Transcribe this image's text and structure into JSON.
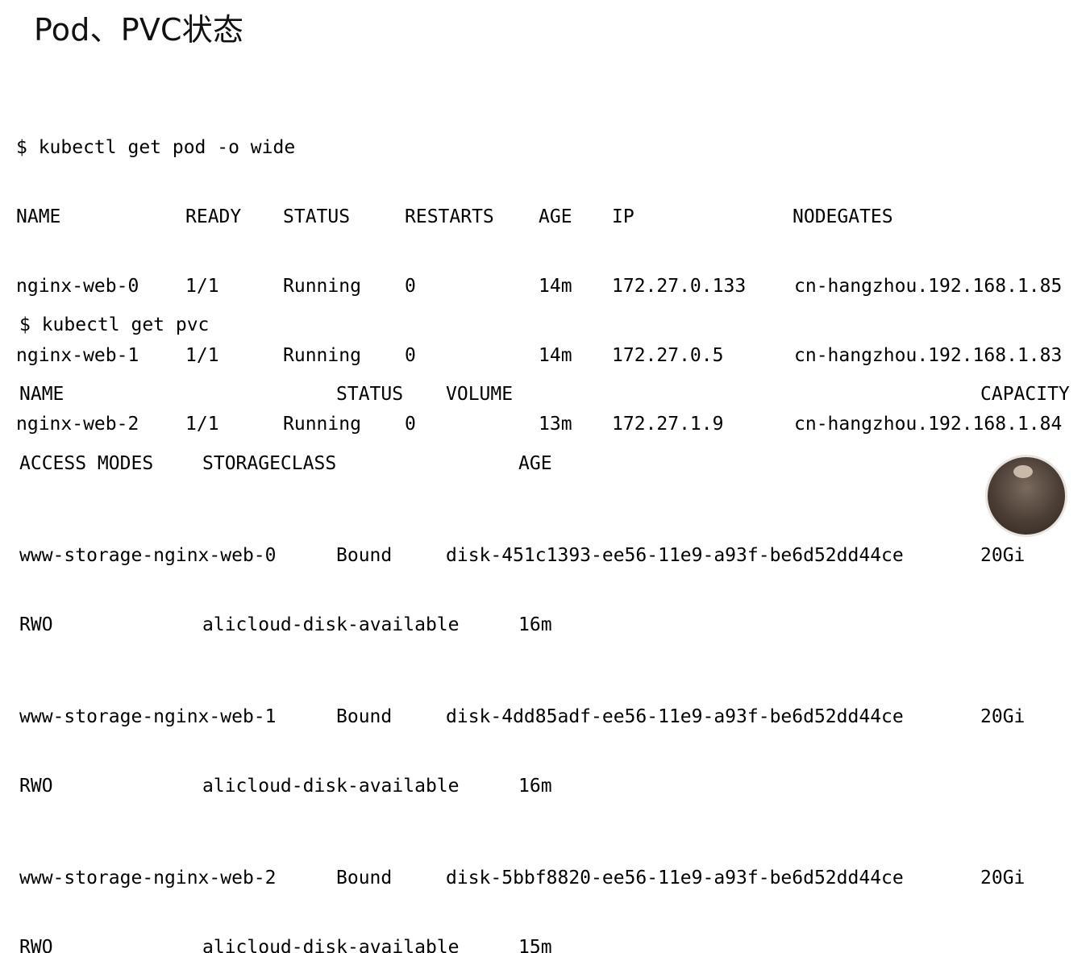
{
  "slide": {
    "title": "Pod、PVC状态"
  },
  "pod_block": {
    "command": "$ kubectl get pod -o wide",
    "headers": [
      "NAME",
      "READY",
      "STATUS",
      "RESTARTS",
      "AGE",
      "IP",
      "NODEGATES"
    ],
    "rows": [
      [
        "nginx-web-0",
        "1/1",
        "Running",
        "0",
        "14m",
        "172.27.0.133",
        "cn-hangzhou.192.168.1.85"
      ],
      [
        "nginx-web-1",
        "1/1",
        "Running",
        "0",
        "14m",
        "172.27.0.5",
        "cn-hangzhou.192.168.1.83"
      ],
      [
        "nginx-web-2",
        "1/1",
        "Running",
        "0",
        "13m",
        "172.27.1.9",
        "cn-hangzhou.192.168.1.84"
      ]
    ]
  },
  "pvc_block": {
    "command": "$ kubectl get pvc",
    "headers_line1": [
      "NAME",
      "STATUS",
      "VOLUME",
      "CAPACITY"
    ],
    "headers_line2": [
      "ACCESS MODES",
      "STORAGECLASS",
      "AGE"
    ],
    "rows": [
      {
        "name": "www-storage-nginx-web-0",
        "status": "Bound",
        "volume": "disk-451c1393-ee56-11e9-a93f-be6d52dd44ce",
        "capacity": "20Gi",
        "access_modes": "RWO",
        "storageclass": "alicloud-disk-available",
        "age": "16m"
      },
      {
        "name": "www-storage-nginx-web-1",
        "status": "Bound",
        "volume": "disk-4dd85adf-ee56-11e9-a93f-be6d52dd44ce",
        "capacity": "20Gi",
        "access_modes": "RWO",
        "storageclass": "alicloud-disk-available",
        "age": "16m"
      },
      {
        "name": "www-storage-nginx-web-2",
        "status": "Bound",
        "volume": "disk-5bbf8820-ee56-11e9-a93f-be6d52dd44ce",
        "capacity": "20Gi",
        "access_modes": "RWO",
        "storageclass": "alicloud-disk-available",
        "age": "15m"
      }
    ]
  }
}
